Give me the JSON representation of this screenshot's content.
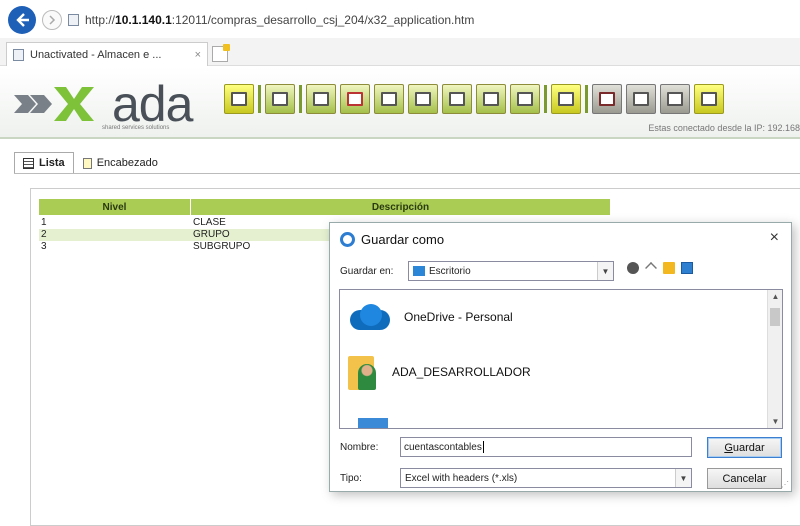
{
  "browser": {
    "url_prefix": "http://",
    "url_host": "10.1.140.1",
    "url_rest": ":12011/compras_desarrollo_csj_204/x32_application.htm",
    "tab_title": "Unactivated - Almacen e ...",
    "tab_close": "×"
  },
  "app": {
    "logo_text": "ada",
    "logo_sub": "shared services solutions",
    "ip_text": "Estas conectado desde la IP: 192.168",
    "tabs": [
      {
        "label": "Lista"
      },
      {
        "label": "Encabezado"
      }
    ]
  },
  "grid": {
    "headers": [
      "Nivel",
      "Descripción"
    ],
    "rows": [
      {
        "nivel": "1",
        "descripcion": "CLASE"
      },
      {
        "nivel": "2",
        "descripcion": "GRUPO"
      },
      {
        "nivel": "3",
        "descripcion": "SUBGRUPO"
      }
    ]
  },
  "dialog": {
    "title": "Guardar como",
    "close": "×",
    "save_in_label": "Guardar en:",
    "save_in_value": "Escritorio",
    "items": [
      {
        "name": "OneDrive - Personal",
        "icon": "onedrive-cloud-icon"
      },
      {
        "name": "ADA_DESARROLLADOR",
        "icon": "user-folder-icon"
      }
    ],
    "name_label": "Nombre:",
    "name_value": "cuentascontables",
    "type_label": "Tipo:",
    "type_value": "Excel with headers (*.xls)",
    "save_button": "Guardar",
    "cancel_button": "Cancelar"
  }
}
